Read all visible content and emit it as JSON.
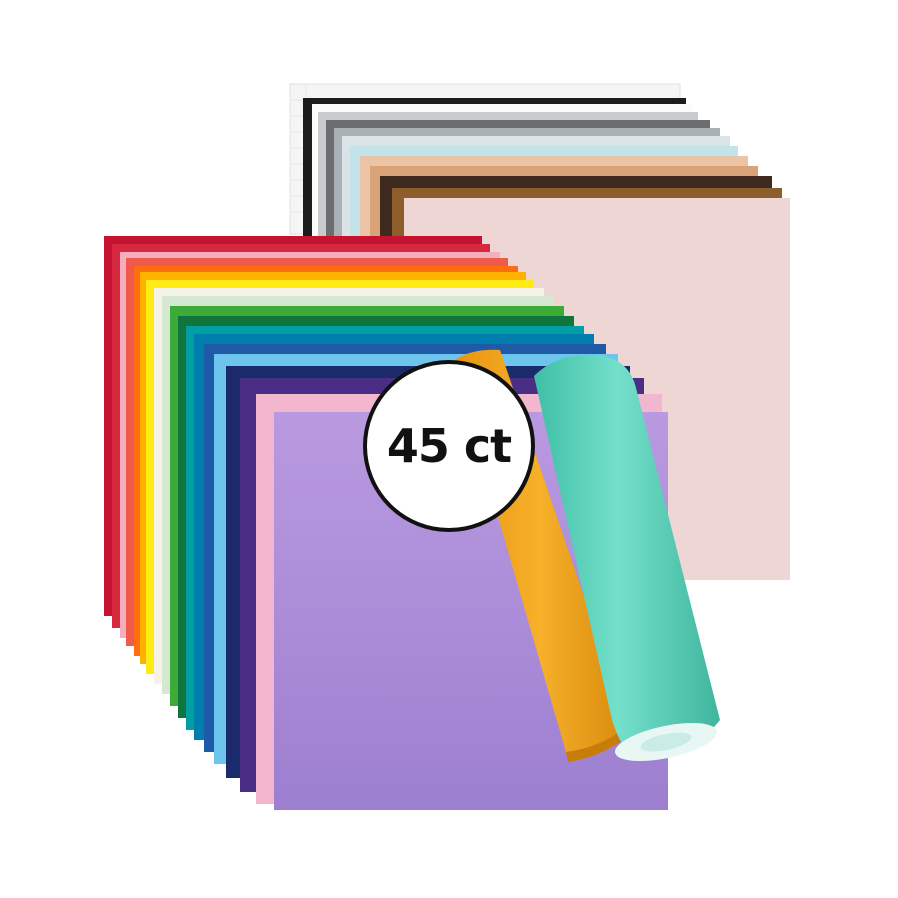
{
  "badge": {
    "count_label": "45 ct"
  },
  "colors": {
    "background": "#ffffff",
    "badge_fill": "#ffffff",
    "badge_border": "#111111",
    "top_stack": [
      "#f4f4f4",
      "#1a1a1a",
      "#ffffff",
      "#c9c9c9",
      "#6b6b6b",
      "#a9b0b6",
      "#d8dfe3",
      "#bfe0e8",
      "#e8c3a8",
      "#d8a57a",
      "#4a3020",
      "#8a5a2b",
      "#edd5d2"
    ],
    "front_stack": [
      "#c8102e",
      "#e03a4e",
      "#f5a9b8",
      "#ff6a13",
      "#ffb000",
      "#fff200",
      "#f2f2e6",
      "#d7e9d4",
      "#3aaa35",
      "#0f7b3f",
      "#00a4a7",
      "#0083b0",
      "#1e5aa8",
      "#6cc4ee",
      "#1b2a6b",
      "#4b2e83",
      "#f2b5cf",
      "#b08ad8"
    ],
    "orange_roll": "#f0a316",
    "teal_roll": "#5fd3bd"
  }
}
